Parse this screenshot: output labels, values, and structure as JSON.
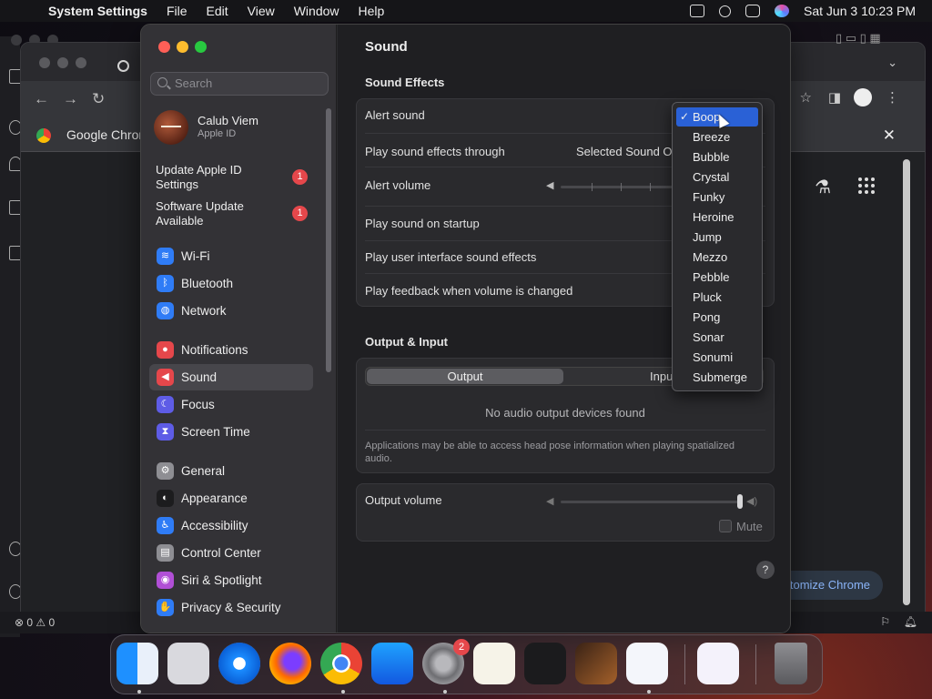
{
  "menubar": {
    "app_name": "System Settings",
    "menus": [
      "File",
      "Edit",
      "View",
      "Window",
      "Help"
    ],
    "clock": "Sat Jun 3  10:23 PM"
  },
  "chrome": {
    "bookmark_label": "Google Chrom",
    "customize_label": "tomize Chrome"
  },
  "vscode": {
    "status": "⊗ 0 ⚠ 0"
  },
  "sidebar": {
    "search_placeholder": "Search",
    "account": {
      "name": "Calub Viem",
      "subtitle": "Apple ID"
    },
    "updates": [
      {
        "label": "Update Apple ID Settings",
        "count": "1"
      },
      {
        "label": "Software Update Available",
        "count": "1"
      }
    ],
    "items": [
      {
        "label": "Wi-Fi",
        "icon": "wifi-icon",
        "color": "#2f7cf6"
      },
      {
        "label": "Bluetooth",
        "icon": "bluetooth-icon",
        "color": "#2f7cf6"
      },
      {
        "label": "Network",
        "icon": "network-icon",
        "color": "#2f7cf6"
      },
      {
        "label": "Notifications",
        "icon": "bell-icon",
        "color": "#e5474b"
      },
      {
        "label": "Sound",
        "icon": "speaker-icon",
        "color": "#e5474b"
      },
      {
        "label": "Focus",
        "icon": "moon-icon",
        "color": "#5e5ce6"
      },
      {
        "label": "Screen Time",
        "icon": "hourglass-icon",
        "color": "#5e5ce6"
      },
      {
        "label": "General",
        "icon": "gear-icon",
        "color": "#8e8e93"
      },
      {
        "label": "Appearance",
        "icon": "appearance-icon",
        "color": "#1c1c1e"
      },
      {
        "label": "Accessibility",
        "icon": "accessibility-icon",
        "color": "#2f7cf6"
      },
      {
        "label": "Control Center",
        "icon": "control-center-icon",
        "color": "#8e8e93"
      },
      {
        "label": "Siri & Spotlight",
        "icon": "siri-icon",
        "color": "#b14fd6"
      },
      {
        "label": "Privacy & Security",
        "icon": "hand-icon",
        "color": "#2f7cf6"
      }
    ]
  },
  "sound": {
    "title": "Sound",
    "effects_heading": "Sound Effects",
    "alert_sound_label": "Alert sound",
    "play_through_label": "Play sound effects through",
    "play_through_value": "Selected Sound O",
    "alert_volume_label": "Alert volume",
    "startup_label": "Play sound on startup",
    "ui_sounds_label": "Play user interface sound effects",
    "feedback_label": "Play feedback when volume is changed",
    "output_input_heading": "Output & Input",
    "tab_output": "Output",
    "tab_input": "Inpu",
    "no_devices": "No audio output devices found",
    "head_pose_note": "Applications may be able to access head pose information when playing spatialized audio.",
    "output_volume_label": "Output volume",
    "output_volume_level": 1.0,
    "mute_label": "Mute",
    "help_label": "?"
  },
  "alert_dropdown": {
    "selected": "Boop",
    "options": [
      "Boop",
      "Breeze",
      "Bubble",
      "Crystal",
      "Funky",
      "Heroine",
      "Jump",
      "Mezzo",
      "Pebble",
      "Pluck",
      "Pong",
      "Sonar",
      "Sonumi",
      "Submerge"
    ]
  },
  "dock": {
    "apps": [
      {
        "name": "finder-icon"
      },
      {
        "name": "launchpad-icon"
      },
      {
        "name": "safari-icon"
      },
      {
        "name": "firefox-icon"
      },
      {
        "name": "chrome-icon"
      },
      {
        "name": "app-store-icon"
      },
      {
        "name": "system-settings-icon",
        "badge": "2"
      },
      {
        "name": "textedit-icon"
      },
      {
        "name": "terminal-icon"
      },
      {
        "name": "garageband-icon"
      },
      {
        "name": "vscode-icon"
      },
      {
        "name": "visual-studio-icon"
      },
      {
        "name": "trash-icon"
      }
    ]
  }
}
